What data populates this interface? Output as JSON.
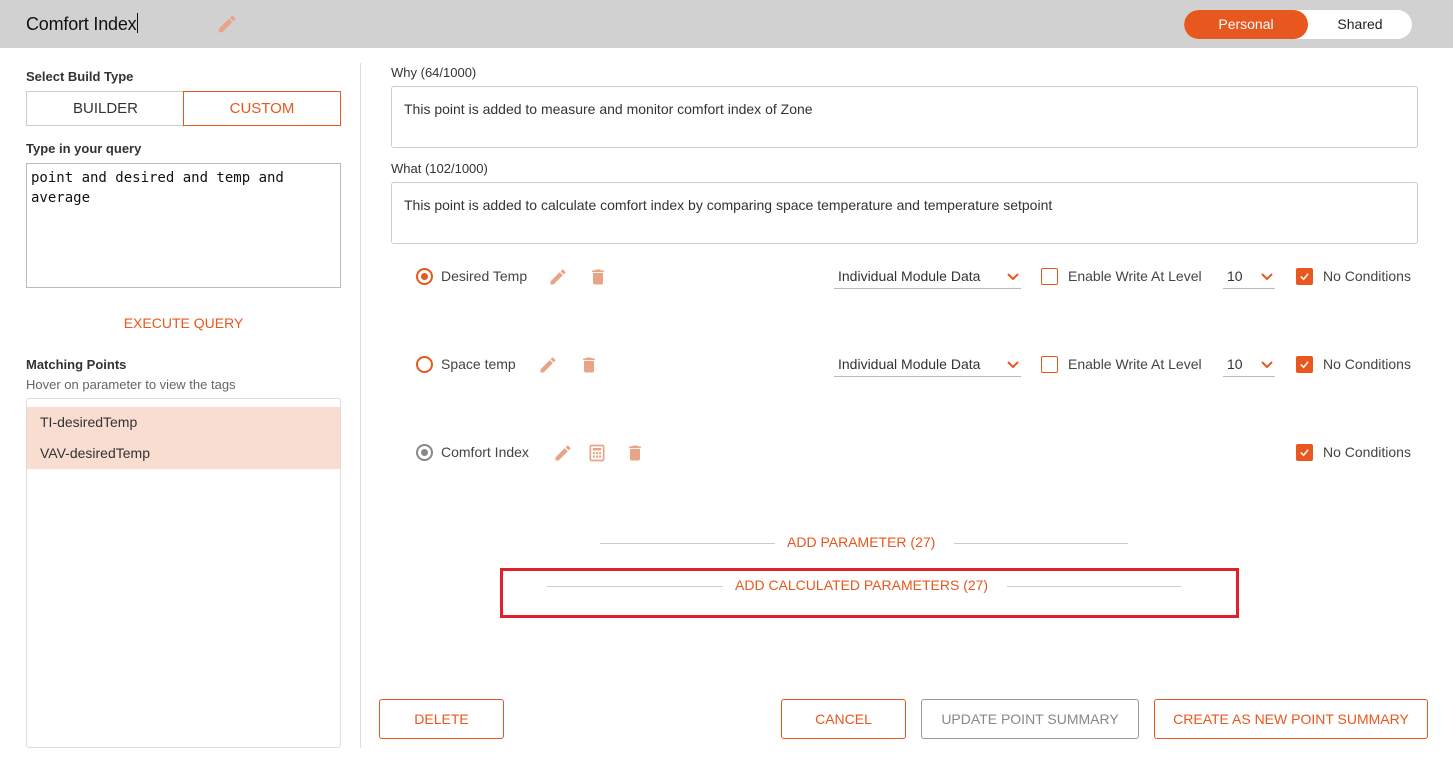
{
  "header": {
    "title": "Comfort Index",
    "toggle": {
      "personal": "Personal",
      "shared": "Shared"
    }
  },
  "left": {
    "build_type_label": "Select Build Type",
    "build_builder": "BUILDER",
    "build_custom": "CUSTOM",
    "query_label": "Type in your query",
    "query_value": "point and desired and temp and average",
    "execute": "EXECUTE QUERY",
    "matching_label": "Matching Points",
    "matching_hint": "Hover on parameter to view the tags",
    "points": [
      "TI-desiredTemp",
      "VAV-desiredTemp"
    ]
  },
  "right": {
    "why_label": "Why (64/1000)",
    "why_text": "This point is added to measure and monitor comfort index of Zone",
    "what_label": "What (102/1000)",
    "what_text": "This point is added to calculate comfort index by comparing space temperature and temperature setpoint",
    "params": [
      {
        "name": "Desired Temp",
        "data_source": "Individual Module Data",
        "write_label": "Enable Write At Level",
        "level": "10",
        "conditions": "No Conditions"
      },
      {
        "name": "Space temp",
        "data_source": "Individual Module Data",
        "write_label": "Enable Write At Level",
        "level": "10",
        "conditions": "No Conditions"
      },
      {
        "name": "Comfort Index",
        "conditions": "No Conditions"
      }
    ],
    "add_parameter": "ADD PARAMETER (27)",
    "add_calculated": "ADD CALCULATED PARAMETERS (27)"
  },
  "footer": {
    "delete": "DELETE",
    "cancel": "CANCEL",
    "update": "UPDATE POINT SUMMARY",
    "create": "CREATE AS NEW POINT SUMMARY"
  },
  "colors": {
    "accent": "#e8571e",
    "highlight": "#e0202a",
    "header_bg": "#d1d1d1",
    "selected_row": "#f9ddd1"
  }
}
